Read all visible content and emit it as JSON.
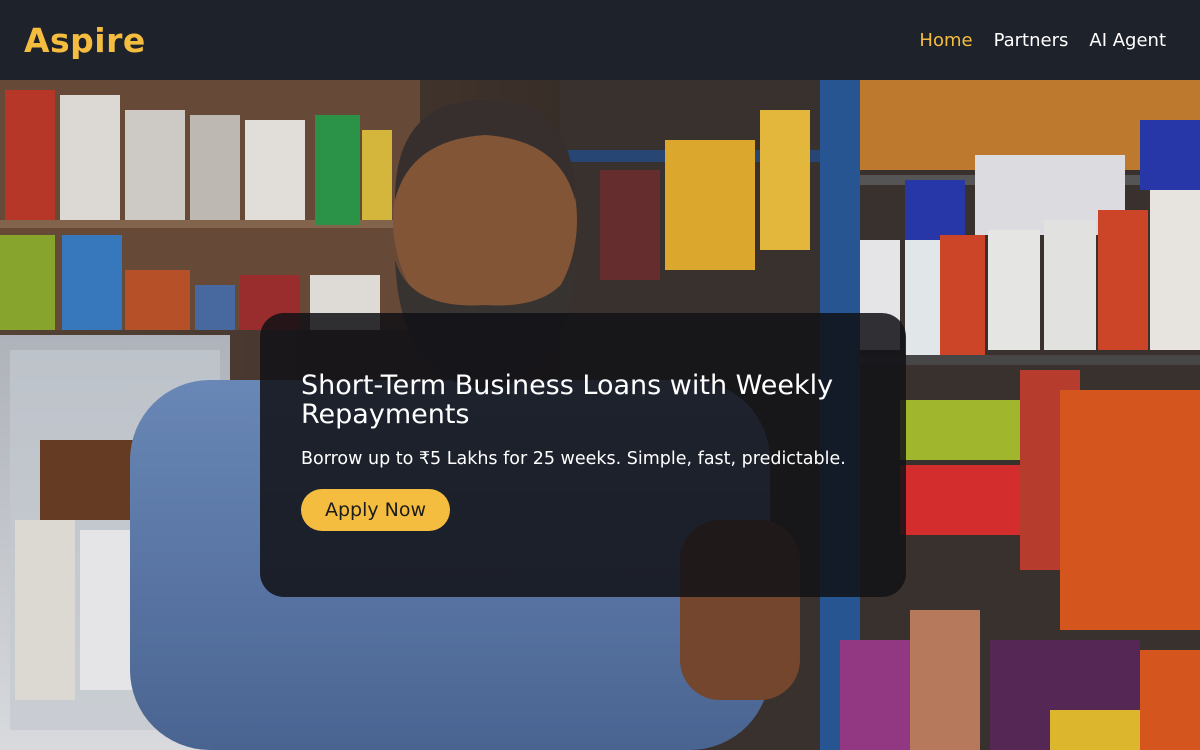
{
  "header": {
    "logo": "Aspire",
    "nav": [
      {
        "label": "Home",
        "active": true
      },
      {
        "label": "Partners",
        "active": false
      },
      {
        "label": "AI Agent",
        "active": false
      }
    ]
  },
  "hero": {
    "background_image": "shopkeeper-thumbs-up-photo",
    "title": "Short-Term Business Loans with Weekly Repayments",
    "subtitle": "Borrow up to ₹5 Lakhs for 25 weeks. Simple, fast, predictable.",
    "cta_label": "Apply Now"
  },
  "colors": {
    "accent": "#f5bd3f",
    "header_bg": "#1e222b",
    "card_bg": "#111216"
  }
}
